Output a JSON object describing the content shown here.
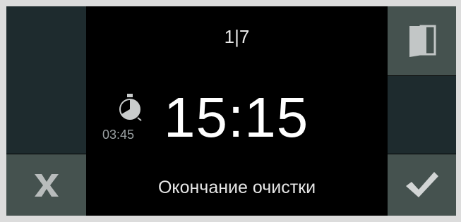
{
  "status": {
    "page_indicator": "1|7"
  },
  "timer": {
    "end_time": "15:15",
    "duration": "03:45"
  },
  "caption": "Окончание очистки",
  "icons": {
    "door": "door-icon",
    "cancel": "close-icon",
    "confirm": "checkmark-icon",
    "timer": "stopwatch-icon"
  },
  "colors": {
    "background": "#000000",
    "panel_dark": "#1e2b2e",
    "panel_grey": "#45524f",
    "text": "#ffffff",
    "muted_text": "#9aa0a2"
  }
}
